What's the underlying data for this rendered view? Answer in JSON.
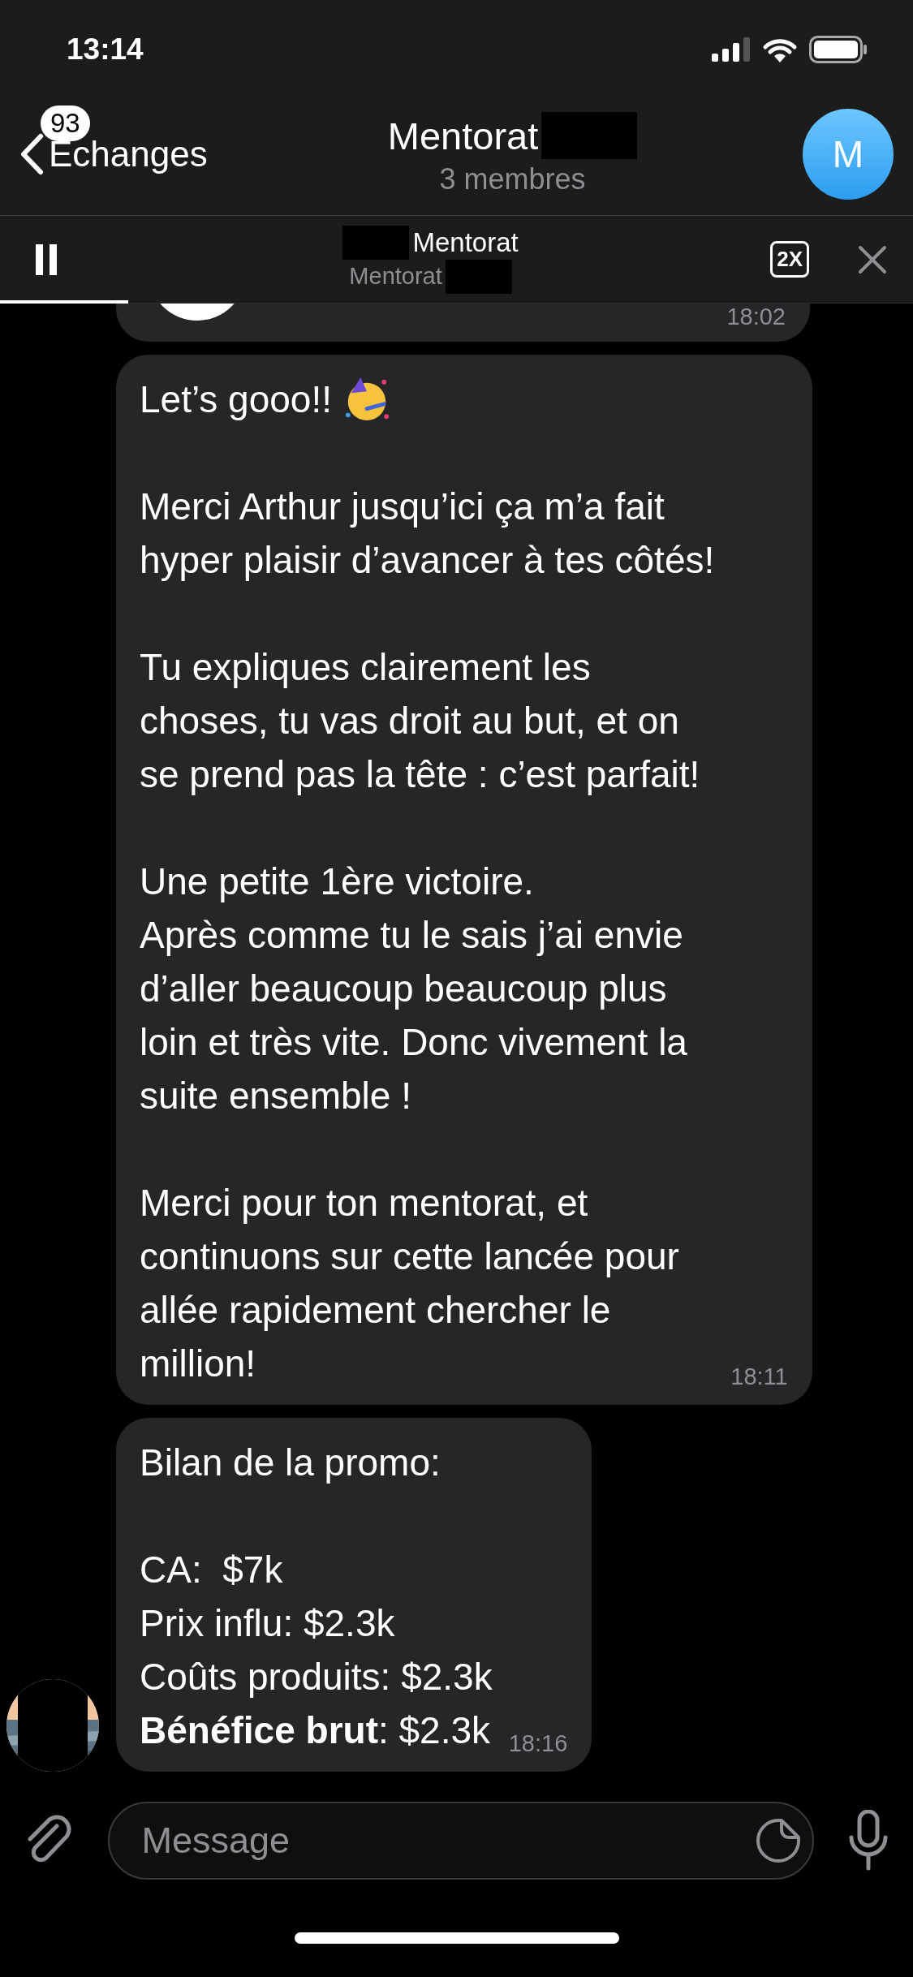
{
  "status_bar": {
    "time": "13:14"
  },
  "header": {
    "back_label": "Echanges",
    "unread_badge": "93",
    "title": "Mentorat",
    "title_redacted": true,
    "subtitle": "3 membres",
    "avatar_letter": "M"
  },
  "player": {
    "title": "Mentorat",
    "title_redacted": true,
    "subtitle": "Mentorat",
    "subtitle_redacted": true,
    "speed": "2X",
    "playing": true,
    "level": 0.14
  },
  "messages": [
    {
      "kind": "media",
      "time": "18:02",
      "avatar": false
    },
    {
      "kind": "text",
      "lead": "Let’s gooo!!",
      "text": "Merci Arthur jusqu’ici ça m’a fait\nhyper plaisir d’avancer à tes côtés!\n\nTu expliques clairement les\nchoses, tu vas droit au but, et on\nse prend pas la tête : c’est parfait!\n\nUne petite 1ère victoire.\nAprès comme tu le sais j’ai envie\nd’aller beaucoup beaucoup plus\nloin et très vite. Donc vivement la\nsuite ensemble !\n\nMerci pour ton mentorat, et\ncontinuons sur cette lancée pour\nallée rapidement chercher le\nmillion!",
      "time": "18:11",
      "avatar": false
    },
    {
      "kind": "text",
      "text": "Bilan de la promo:\n\nCA:  $7k\nPrix influ: $2.3k\nCoûts produits: $2.3k\n**Bénéfice brut**: $2.3k",
      "time": "18:16",
      "avatar": true
    }
  ],
  "composer": {
    "placeholder": "Message"
  }
}
